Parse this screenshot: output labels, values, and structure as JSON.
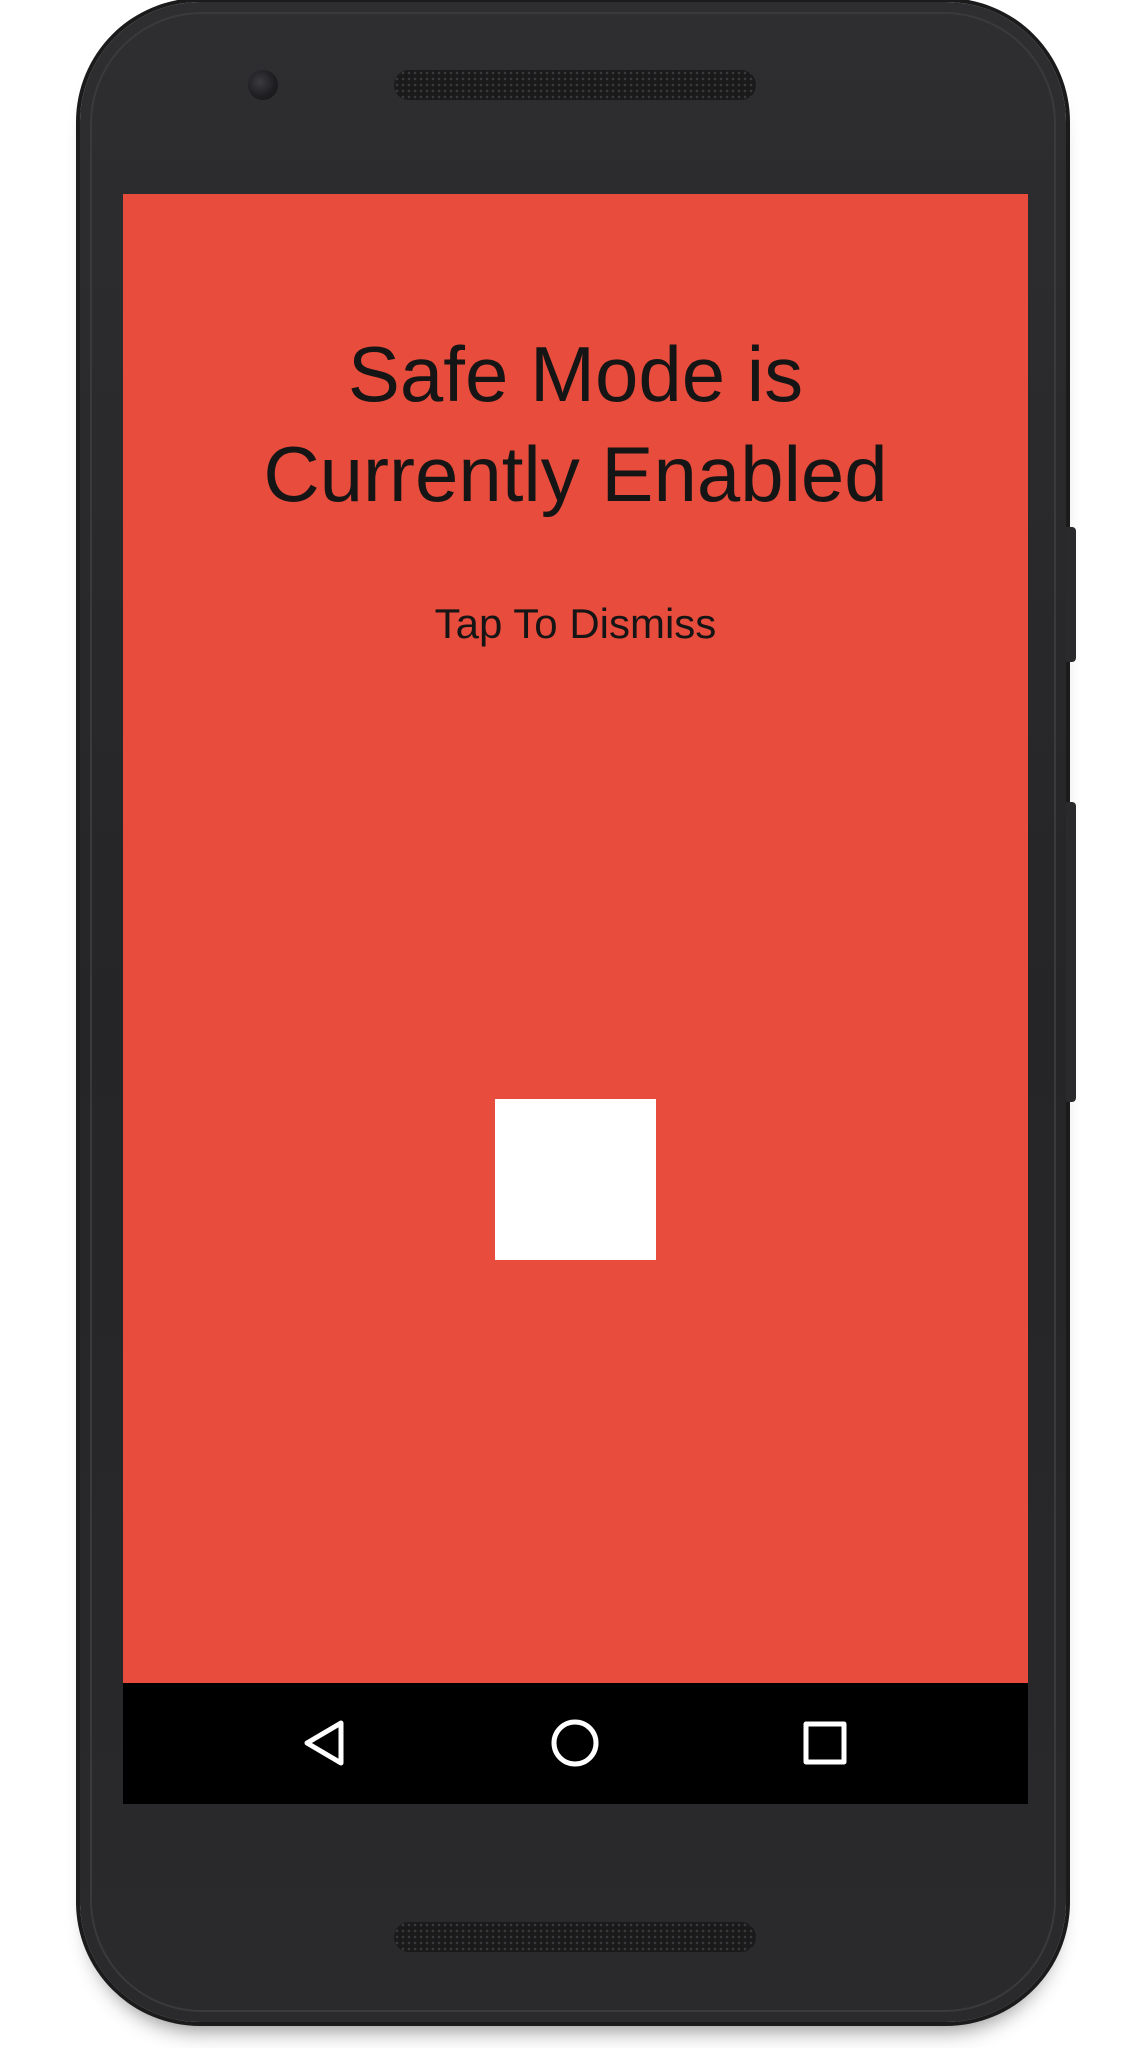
{
  "screen": {
    "background_color": "#E74C3C",
    "title": "Safe Mode is\nCurrently Enabled",
    "dismiss_label": "Tap To Dismiss"
  },
  "navbar": {
    "back_icon": "back-triangle-icon",
    "home_icon": "home-circle-icon",
    "recents_icon": "recents-square-icon"
  },
  "device": {
    "body_color": "#2A2A2C"
  }
}
